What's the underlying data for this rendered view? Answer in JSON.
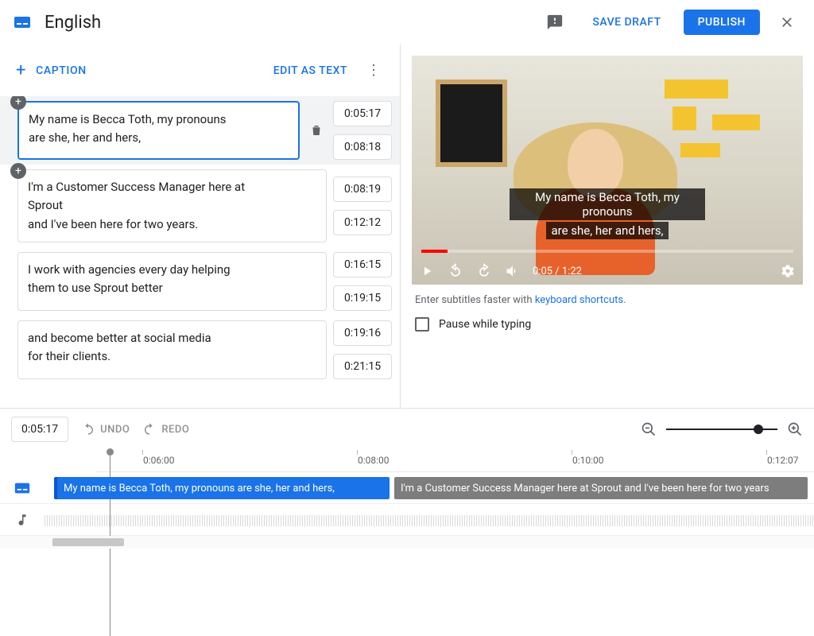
{
  "header": {
    "title": "English",
    "save_draft": "SAVE DRAFT",
    "publish": "PUBLISH"
  },
  "left": {
    "add_caption": "CAPTION",
    "edit_as_text": "EDIT AS TEXT"
  },
  "captions": [
    {
      "line1": "My name is Becca Toth, my pronouns",
      "line2": "are she, her and hers,",
      "start": "0:05:17",
      "end": "0:08:18",
      "selected": true
    },
    {
      "line1": "I'm a Customer Success Manager here at",
      "line2": "Sprout",
      "line3": "and I've been here for two years.",
      "start": "0:08:19",
      "end": "0:12:12"
    },
    {
      "line1": "I work with agencies every day helping",
      "line2": "them to use Sprout better",
      "start": "0:16:15",
      "end": "0:19:15"
    },
    {
      "line1": "and become better at social media",
      "line2": "for their clients.",
      "start": "0:19:16",
      "end": "0:21:15"
    }
  ],
  "video": {
    "subtitle_line1": "My name is Becca Toth, my pronouns",
    "subtitle_line2": "are she, her and hers,",
    "time_display": "0:05 / 1:22"
  },
  "hint": {
    "prefix": "Enter subtitles faster with ",
    "link": "keyboard shortcuts",
    "suffix": "."
  },
  "pause_label": "Pause while typing",
  "timeline": {
    "current": "0:05:17",
    "undo": "UNDO",
    "redo": "REDO",
    "ticks": [
      "0:06:00",
      "0:08:00",
      "0:10:00",
      "0:12:07"
    ],
    "seg1": "My name is Becca Toth, my pronouns are she, her and hers,",
    "seg2": "I'm a Customer Success Manager here at Sprout and I've been here for two years"
  }
}
